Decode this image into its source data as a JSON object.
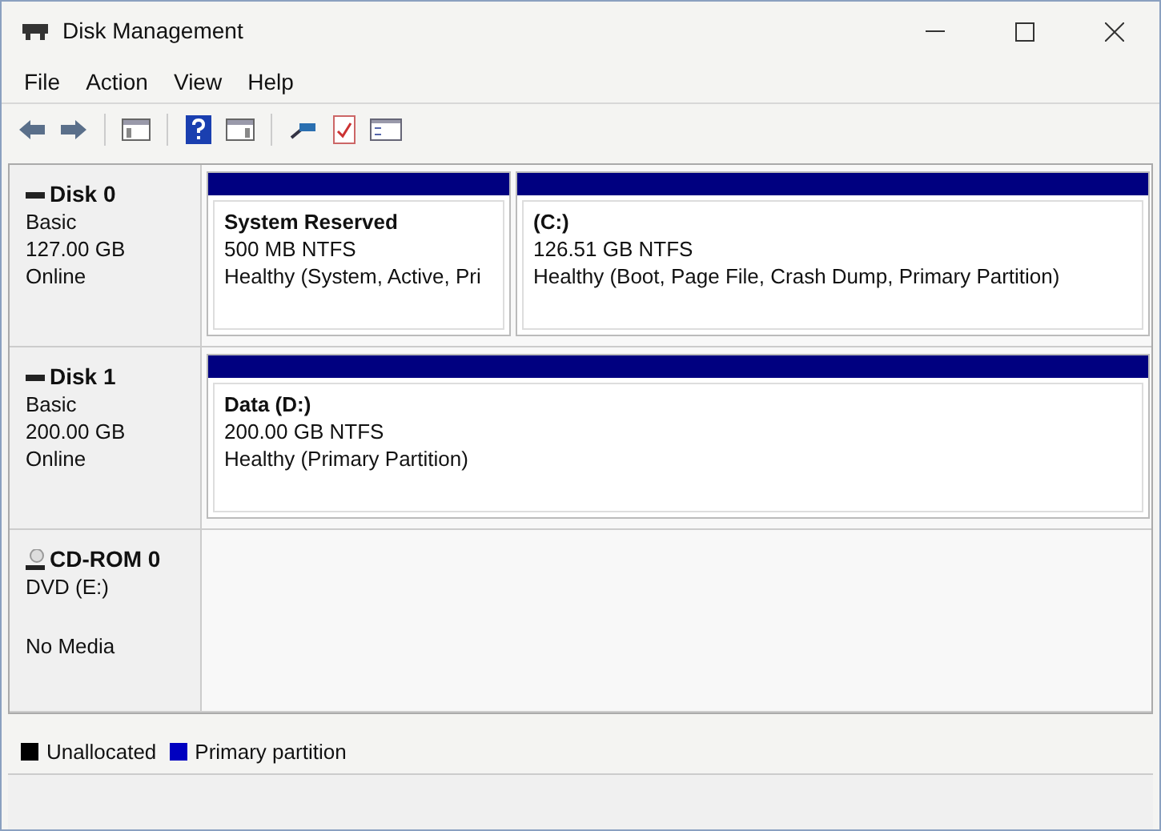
{
  "window": {
    "title": "Disk Management"
  },
  "menu": [
    "File",
    "Action",
    "View",
    "Help"
  ],
  "disks": [
    {
      "kind": "disk",
      "name": "Disk 0",
      "lines": [
        "Basic",
        "127.00 GB",
        "Online"
      ],
      "partitions": [
        {
          "label": "System Reserved",
          "size": "500 MB NTFS",
          "status": "Healthy (System, Active, Pri",
          "color": "#000080"
        },
        {
          "label": "(C:)",
          "size": "126.51 GB NTFS",
          "status": "Healthy (Boot, Page File, Crash Dump, Primary Partition)",
          "color": "#000080"
        }
      ]
    },
    {
      "kind": "disk",
      "name": "Disk 1",
      "lines": [
        "Basic",
        "200.00 GB",
        "Online"
      ],
      "partitions": [
        {
          "label": "Data  (D:)",
          "size": "200.00 GB NTFS",
          "status": "Healthy (Primary Partition)",
          "color": "#000080"
        }
      ]
    },
    {
      "kind": "cdrom",
      "name": "CD-ROM 0",
      "lines": [
        "DVD (E:)",
        "No Media"
      ]
    }
  ],
  "legend": [
    {
      "label": "Unallocated",
      "color": "#000000"
    },
    {
      "label": "Primary partition",
      "color": "#0000c0"
    }
  ]
}
